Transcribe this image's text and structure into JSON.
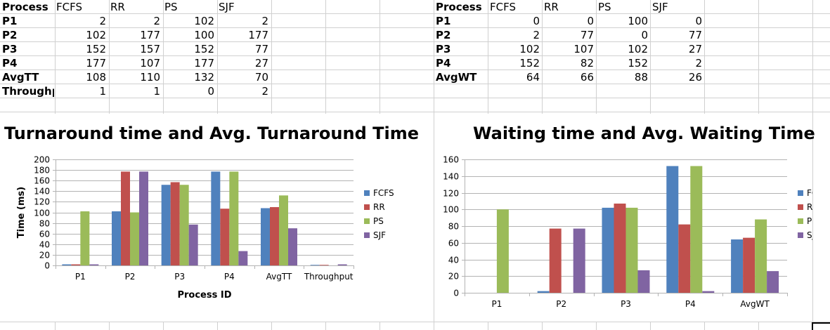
{
  "colors": {
    "FCFS": "#4f81bd",
    "RR": "#c0504d",
    "PS": "#9bbb59",
    "SJF": "#8064a2"
  },
  "table_left": {
    "header": [
      "Process",
      "FCFS",
      "RR",
      "PS",
      "SJF"
    ],
    "rows": [
      [
        "P1",
        "2",
        "2",
        "102",
        "2"
      ],
      [
        "P2",
        "102",
        "177",
        "100",
        "177"
      ],
      [
        "P3",
        "152",
        "157",
        "152",
        "77"
      ],
      [
        "P4",
        "177",
        "107",
        "177",
        "27"
      ],
      [
        "AvgTT",
        "108",
        "110",
        "132",
        "70"
      ],
      [
        "Throughput",
        "1",
        "1",
        "0",
        "2"
      ]
    ]
  },
  "table_right": {
    "header": [
      "Process",
      "FCFS",
      "RR",
      "PS",
      "SJF"
    ],
    "rows": [
      [
        "P1",
        "0",
        "0",
        "100",
        "0"
      ],
      [
        "P2",
        "2",
        "77",
        "0",
        "77"
      ],
      [
        "P3",
        "102",
        "107",
        "102",
        "27"
      ],
      [
        "P4",
        "152",
        "82",
        "152",
        "2"
      ],
      [
        "AvgWT",
        "64",
        "66",
        "88",
        "26"
      ]
    ]
  },
  "chart_data": [
    {
      "type": "bar",
      "title": "Turnaround time and Avg. Turnaround Time",
      "xlabel": "Process ID",
      "ylabel": "Time (ms)",
      "ylim": [
        0,
        200
      ],
      "ytick_step": 20,
      "grid": true,
      "legend_placement": "right",
      "categories": [
        "P1",
        "P2",
        "P3",
        "P4",
        "AvgTT",
        "Throughput"
      ],
      "series": [
        {
          "name": "FCFS",
          "values": [
            2,
            102,
            152,
            177,
            108,
            1
          ]
        },
        {
          "name": "RR",
          "values": [
            2,
            177,
            157,
            107,
            110,
            1
          ]
        },
        {
          "name": "PS",
          "values": [
            102,
            100,
            152,
            177,
            132,
            0
          ]
        },
        {
          "name": "SJF",
          "values": [
            2,
            177,
            77,
            27,
            70,
            2
          ]
        }
      ]
    },
    {
      "type": "bar",
      "title": "Waiting time and Avg. Waiting Time",
      "xlabel": "",
      "ylabel": "",
      "ylim": [
        0,
        160
      ],
      "ytick_step": 20,
      "grid": true,
      "legend_placement": "right",
      "categories": [
        "P1",
        "P2",
        "P3",
        "P4",
        "AvgWT"
      ],
      "series": [
        {
          "name": "FCFS",
          "values": [
            0,
            2,
            102,
            152,
            64
          ]
        },
        {
          "name": "RR",
          "values": [
            0,
            77,
            107,
            82,
            66
          ]
        },
        {
          "name": "PS",
          "values": [
            100,
            0,
            102,
            152,
            88
          ]
        },
        {
          "name": "SJF",
          "values": [
            0,
            77,
            27,
            2,
            26
          ]
        }
      ]
    }
  ]
}
